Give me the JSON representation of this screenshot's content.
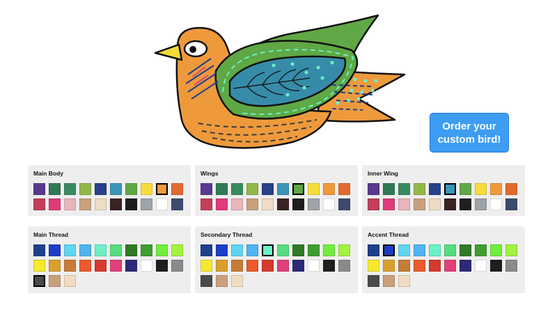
{
  "order_button": {
    "label": "Order your custom bird!"
  },
  "bird": {
    "main_body_color": "#ee9a3c",
    "wing_color": "#5fa845",
    "inner_wing_color": "#368ca8",
    "main_thread_color": "#3a3a3a",
    "secondary_thread_color": "#6df0c8",
    "accent_thread_color": "#1e3f8c",
    "beak_color": "#f2da3a"
  },
  "palettes": {
    "body": [
      "#59398f",
      "#2f7a55",
      "#3a8a60",
      "#93b84a",
      "#27418a",
      "#3a95b8",
      "#5fa845",
      "#f7dd3c",
      "#ee9a3c",
      "#e46a30",
      "#c43e5a",
      "#e03a7a",
      "#e8b5bd",
      "#c9a07c",
      "#f0dcc4",
      "#3a2222",
      "#1e1e1e",
      "#9ea3a8",
      "#ffffff",
      "#3d4a6e"
    ],
    "thread": [
      "#1e3f8c",
      "#1c3dc7",
      "#5fd5f0",
      "#4fb4ef",
      "#6df0c8",
      "#56dd80",
      "#2f7a25",
      "#3e9e30",
      "#72ed3e",
      "#a3f23e",
      "#f7ea2e",
      "#d9a02c",
      "#c67c38",
      "#ec5a2c",
      "#d53a2c",
      "#e0407a",
      "#2e2878",
      "#ffffff",
      "#1e1e1e",
      "#8a8a8a",
      "#4a4a4a",
      "#c9a07c",
      "#f0dcc4"
    ]
  },
  "panels": [
    {
      "title": "Main Body",
      "palette": "body",
      "selected": 8
    },
    {
      "title": "Wings",
      "palette": "body",
      "selected": 6
    },
    {
      "title": "Inner Wing",
      "palette": "body",
      "selected": 5
    },
    {
      "title": "Main Thread",
      "palette": "thread",
      "selected": 20
    },
    {
      "title": "Secondary Thread",
      "palette": "thread",
      "selected": 4
    },
    {
      "title": "Accent Thread",
      "palette": "thread",
      "selected": 1
    }
  ]
}
